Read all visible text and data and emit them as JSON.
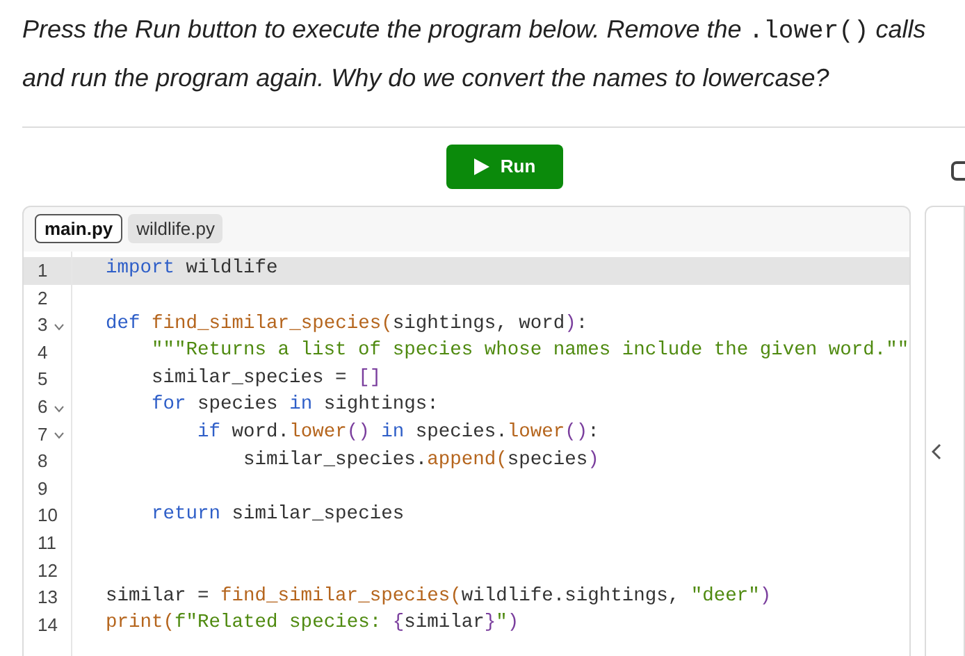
{
  "instructions": {
    "before": "Press the Run button to execute the program below. Remove the",
    "code": ".lower()",
    "after": "calls and run the program again. Why do we convert the names to lowercase?"
  },
  "run_button": {
    "label": "Run"
  },
  "side_checkbox": {
    "checked": false
  },
  "editor": {
    "tabs": [
      {
        "label": "main.py",
        "selected": true
      },
      {
        "label": "wildlife.py",
        "selected": false
      }
    ],
    "lines": [
      {
        "number": "1",
        "foldable": false,
        "selected": true,
        "tokens": [
          {
            "kind": "keyword",
            "text": "import"
          },
          {
            "kind": "plain",
            "text": " wildlife"
          }
        ]
      },
      {
        "number": "2",
        "foldable": false,
        "selected": false
      },
      {
        "number": "3",
        "foldable": true,
        "selected": false,
        "tokens": [
          {
            "kind": "keyword",
            "text": "def "
          },
          {
            "kind": "function",
            "text": "find_similar_species("
          },
          {
            "kind": "plain",
            "text": "sightings, word"
          },
          {
            "kind": "punct",
            "text": ")"
          },
          {
            "kind": "plain",
            "text": ":"
          }
        ]
      },
      {
        "number": "4",
        "foldable": false,
        "selected": false,
        "tokens": [
          {
            "kind": "string",
            "text": "    \"\"\"Returns a list of species whose names include the given word.\"\""
          }
        ]
      },
      {
        "number": "5",
        "foldable": false,
        "selected": false,
        "tokens": [
          {
            "kind": "plain",
            "text": "    similar_species = "
          },
          {
            "kind": "punct",
            "text": "[]"
          }
        ]
      },
      {
        "number": "6",
        "foldable": true,
        "selected": false,
        "tokens": [
          {
            "kind": "keyword",
            "text": "    for"
          },
          {
            "kind": "plain",
            "text": " species "
          },
          {
            "kind": "keyword",
            "text": "in"
          },
          {
            "kind": "plain",
            "text": " sightings:"
          }
        ]
      },
      {
        "number": "7",
        "foldable": true,
        "selected": false,
        "tokens": [
          {
            "kind": "keyword",
            "text": "        if"
          },
          {
            "kind": "plain",
            "text": " word."
          },
          {
            "kind": "function",
            "text": "lower"
          },
          {
            "kind": "punct",
            "text": "()"
          },
          {
            "kind": "keyword",
            "text": " in"
          },
          {
            "kind": "plain",
            "text": " species."
          },
          {
            "kind": "function",
            "text": "lower"
          },
          {
            "kind": "punct",
            "text": "()"
          },
          {
            "kind": "plain",
            "text": ":"
          }
        ]
      },
      {
        "number": "8",
        "foldable": false,
        "selected": false,
        "tokens": [
          {
            "kind": "plain",
            "text": "            similar_species."
          },
          {
            "kind": "function",
            "text": "append("
          },
          {
            "kind": "plain",
            "text": "species"
          },
          {
            "kind": "punct",
            "text": ")"
          }
        ]
      },
      {
        "number": "9",
        "foldable": false,
        "selected": false
      },
      {
        "number": "10",
        "foldable": false,
        "selected": false,
        "tokens": [
          {
            "kind": "keyword",
            "text": "    return"
          },
          {
            "kind": "plain",
            "text": " similar_species"
          }
        ]
      },
      {
        "number": "11",
        "foldable": false,
        "selected": false
      },
      {
        "number": "12",
        "foldable": false,
        "selected": false
      },
      {
        "number": "13",
        "foldable": false,
        "selected": false,
        "tokens": [
          {
            "kind": "plain",
            "text": "similar = "
          },
          {
            "kind": "function",
            "text": "find_similar_species("
          },
          {
            "kind": "plain",
            "text": "wildlife.sightings, "
          },
          {
            "kind": "string",
            "text": "\"deer\""
          },
          {
            "kind": "punct",
            "text": ")"
          }
        ]
      },
      {
        "number": "14",
        "foldable": false,
        "selected": false,
        "tokens": [
          {
            "kind": "function",
            "text": "print("
          },
          {
            "kind": "string",
            "text": "f\"Related species: "
          },
          {
            "kind": "punct",
            "text": "{"
          },
          {
            "kind": "plain",
            "text": "similar"
          },
          {
            "kind": "punct",
            "text": "}"
          },
          {
            "kind": "string",
            "text": "\""
          },
          {
            "kind": "punct",
            "text": ")"
          }
        ]
      }
    ]
  }
}
